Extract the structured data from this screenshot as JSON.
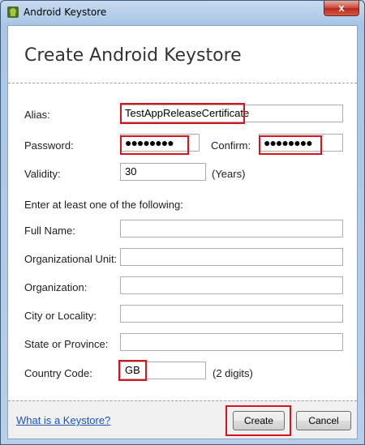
{
  "window": {
    "title": "Android Keystore",
    "close_label": "x"
  },
  "header": {
    "title": "Create Android Keystore"
  },
  "form": {
    "alias": {
      "label": "Alias:",
      "value": "TestAppReleaseCertificate"
    },
    "password": {
      "label": "Password:",
      "value": "●●●●●●●●"
    },
    "confirm": {
      "label": "Confirm:",
      "value": "●●●●●●●●"
    },
    "validity": {
      "label": "Validity:",
      "value": "30",
      "unit": "(Years)"
    },
    "instructions": "Enter at least one of the following:",
    "full_name": {
      "label": "Full Name:",
      "value": ""
    },
    "org_unit": {
      "label": "Organizational Unit:",
      "value": ""
    },
    "organization": {
      "label": "Organization:",
      "value": ""
    },
    "city": {
      "label": "City or Locality:",
      "value": ""
    },
    "state": {
      "label": "State or Province:",
      "value": ""
    },
    "country": {
      "label": "Country Code:",
      "value": "GB",
      "hint": "(2 digits)"
    }
  },
  "footer": {
    "help_link": "What is a Keystore?",
    "create_label": "Create",
    "cancel_label": "Cancel"
  },
  "colors": {
    "highlight": "#d7131d",
    "link": "#1a53b8"
  },
  "icons": {
    "app": "android-keystore-icon",
    "close": "close-icon"
  }
}
